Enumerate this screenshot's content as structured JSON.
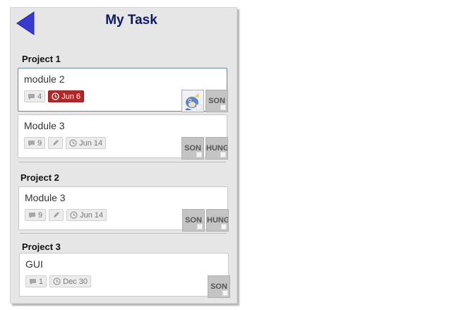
{
  "header": {
    "title": "My Task",
    "back_icon": "back-arrow-icon"
  },
  "accent_colors": {
    "title": "#0f1a66",
    "back_arrow": "#3a3ad2",
    "overdue": "#b22727"
  },
  "projects": [
    {
      "name": "Project 1",
      "tasks": [
        {
          "title": "module 2",
          "comments": "4",
          "due": "Jun 6",
          "due_status": "overdue",
          "assignees": [
            "",
            "SON"
          ]
        },
        {
          "title": "Module 3",
          "comments": "9",
          "due": "Jun 14",
          "assignees": [
            "SON",
            "HUNG"
          ]
        }
      ]
    },
    {
      "name": "Project 2",
      "tasks": [
        {
          "title": "Module 3",
          "comments": "9",
          "due": "Jun 14",
          "assignees": [
            "SON",
            "HUNG"
          ]
        }
      ]
    },
    {
      "name": "Project 3",
      "tasks": [
        {
          "title": "GUI",
          "comments": "1",
          "due": "Dec 30",
          "assignees": [
            "SON"
          ]
        }
      ]
    }
  ]
}
